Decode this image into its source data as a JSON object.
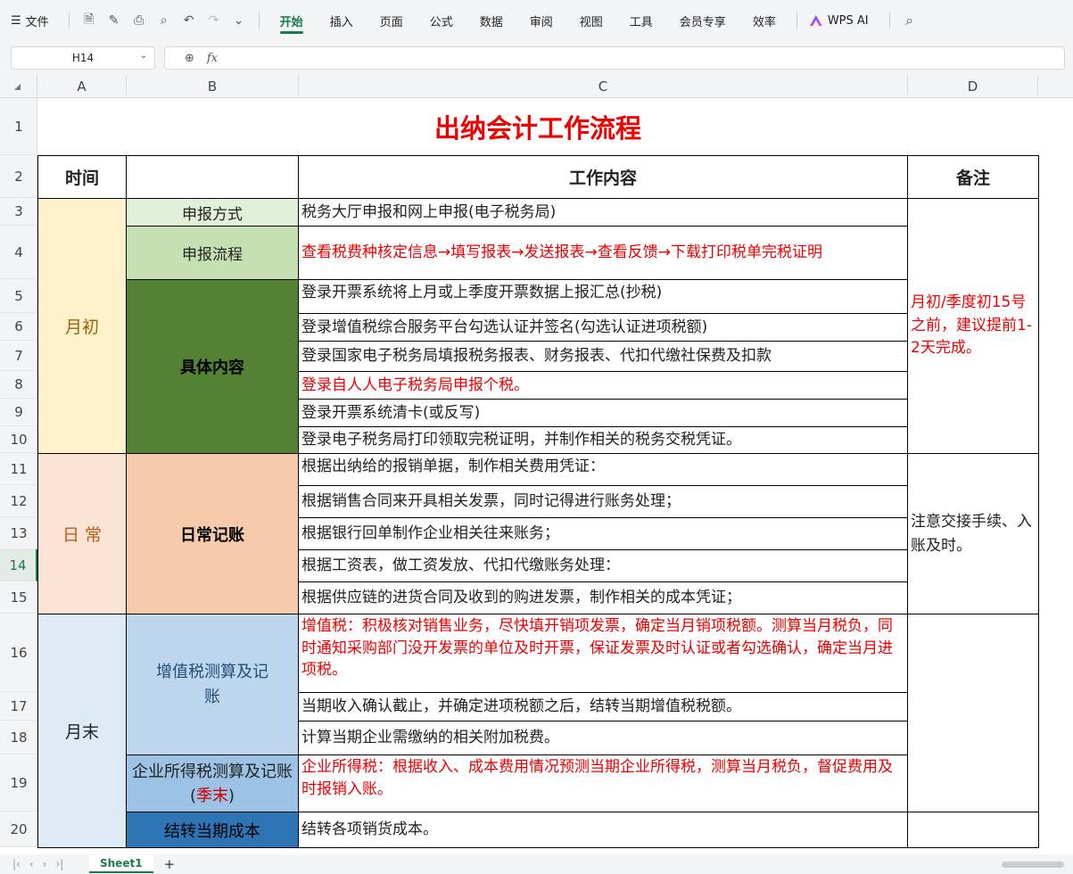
{
  "menubar": {
    "file_label": "文件",
    "items": [
      "开始",
      "插入",
      "页面",
      "公式",
      "数据",
      "审阅",
      "视图",
      "工具",
      "会员专享",
      "效率"
    ],
    "active": "开始",
    "ai_label": "WPS AI",
    "accent": "#1a7a4c"
  },
  "formula_bar": {
    "cell_ref": "H14",
    "fx_label": "fx",
    "value": ""
  },
  "columns": [
    "A",
    "B",
    "C",
    "D"
  ],
  "rows": [
    "1",
    "2",
    "3",
    "4",
    "5",
    "6",
    "7",
    "8",
    "9",
    "10",
    "11",
    "12",
    "13",
    "14",
    "15",
    "16",
    "17",
    "18",
    "19",
    "20"
  ],
  "selected_row": "14",
  "sheet": {
    "title": "出纳会计工作流程",
    "headers": {
      "time": "时间",
      "b": "",
      "content": "工作内容",
      "note": "备注"
    },
    "early": {
      "label": "月初",
      "sub1": "申报方式",
      "sub2": "申报流程",
      "sub3": "具体内容",
      "row3": "税务大厅申报和网上申报(电子税务局)",
      "row4": "查看税费种核定信息→填写报表→发送报表→查看反馈→下载打印税单完税证明",
      "row5": "登录开票系统将上月或上季度开票数据上报汇总(抄税)",
      "row6": "登录增值税综合服务平台勾选认证并签名(勾选认证进项税额)",
      "row7": "登录国家电子税务局填报税务报表、财务报表、代扣代缴社保费及扣款",
      "row8": "登录自人人电子税务局申报个税。",
      "row9": "登录开票系统清卡(或反写)",
      "row10": "登录电子税务局打印领取完税证明，并制作相关的税务交税凭证。",
      "note": "月初/季度初15号之前，建议提前1-2天完成。"
    },
    "daily": {
      "label": "日 常",
      "sub": "日常记账",
      "row11": "根据出纳给的报销单据，制作相关费用凭证：",
      "row12": "根据销售合同来开具相关发票，同时记得进行账务处理；",
      "row13": "根据银行回单制作企业相关往来账务；",
      "row14": "根据工资表，做工资发放、代扣代缴账务处理：",
      "row15": "根据供应链的进货合同及收到的购进发票，制作相关的成本凭证；",
      "note": "注意交接手续、入账及时。"
    },
    "late": {
      "label": "月末",
      "sub1": "增值税测算及记账",
      "sub2_a": "企业所得税测算及记账(",
      "sub2_b": "季末",
      "sub2_c": ")",
      "sub3": "结转当期成本",
      "row16": "增值税：积极核对销售业务，尽快填开销项发票，确定当月销项税额。测算当月税负，同时通知采购部门没开发票的单位及时开票，保证发票及时认证或者勾选确认，确定当月进项税。",
      "row17": "当期收入确认截止，并确定进项税额之后，结转当期增值税税额。",
      "row18": "计算当期企业需缴纳的相关附加税费。",
      "row19": "企业所得税：根据收入、成本费用情况预测当期企业所得税，测算当月税负，督促费用及时报销入账。",
      "row20": "结转各项销货成本。"
    }
  },
  "colors": {
    "early_bg": "#fdf2cc",
    "early_sub_light": "#e2efd9",
    "early_sub_mid": "#c5e0b3",
    "early_sub_dark": "#548235",
    "daily_bg": "#fbe4d5",
    "daily_sub": "#f7caac",
    "late_bg": "#deeaf6",
    "late_sub1": "#bdd6ee",
    "late_sub2": "#9cc2e5",
    "late_sub3": "#2e74b5",
    "red": "#e00000"
  },
  "sheetbar": {
    "tab": "Sheet1",
    "add": "+"
  }
}
